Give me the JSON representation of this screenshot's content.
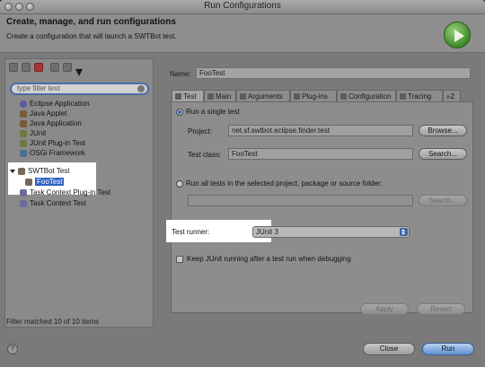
{
  "window": {
    "title": "Run Configurations"
  },
  "header": {
    "title": "Create, manage, and run configurations",
    "subtitle": "Create a configuration that will launch a SWTBot test."
  },
  "left": {
    "filter_placeholder": "type filter text",
    "tree": [
      {
        "label": "Eclipse Application",
        "icon": "eclipse-icon"
      },
      {
        "label": "Java Applet",
        "icon": "java-applet-icon"
      },
      {
        "label": "Java Application",
        "icon": "java-app-icon"
      },
      {
        "label": "JUnit",
        "icon": "junit-icon"
      },
      {
        "label": "JUnit Plug-in Test",
        "icon": "junit-plugin-icon"
      },
      {
        "label": "OSGi Framework",
        "icon": "osgi-icon"
      },
      {
        "label": "SWTBot Test",
        "icon": "swtbot-icon"
      },
      {
        "label": "FooTest",
        "icon": "test-config-icon"
      },
      {
        "label": "Task Context Plug-in Test",
        "icon": "task-context-icon"
      },
      {
        "label": "Task Context Test",
        "icon": "task-context-icon"
      }
    ],
    "status": "Filter matched 10 of 10 items"
  },
  "right": {
    "name_label": "Name:",
    "name_value": "FooTest",
    "tabs": [
      "Test",
      "Main",
      "Arguments",
      "Plug-ins",
      "Configuration",
      "Tracing",
      "»2"
    ],
    "run_single": "Run a single test",
    "project_label": "Project:",
    "project_value": "net.sf.swtbot.eclipse.finder.test",
    "browse": "Browse...",
    "test_class_label": "Test class:",
    "test_class_value": "FooTest",
    "search": "Search...",
    "run_all": "Run all tests in the selected project, package or source folder:",
    "search2": "Search...",
    "runner_label": "Test runner:",
    "runner_value": "JUnit 3",
    "keep_running": "Keep JUnit running after a test run when debugging",
    "apply": "Apply",
    "revert": "Revert"
  },
  "footer": {
    "help": "?",
    "close": "Close",
    "run": "Run"
  }
}
